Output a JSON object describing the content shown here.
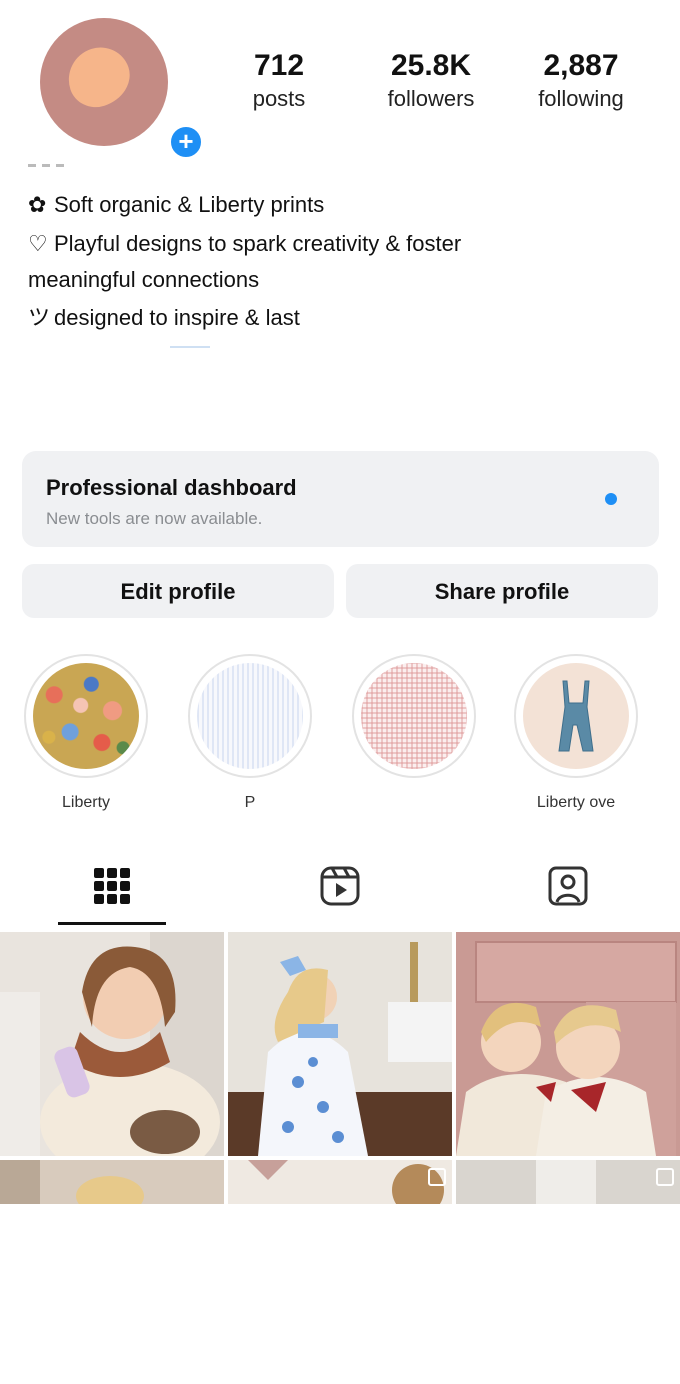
{
  "profile": {
    "stats": [
      {
        "value": "712",
        "label": "posts"
      },
      {
        "value": "25.8K",
        "label": "followers"
      },
      {
        "value": "2,887",
        "label": "following"
      }
    ],
    "add_story_symbol": "+",
    "bio": [
      {
        "icon": "✿",
        "text": "Soft organic & Liberty prints"
      },
      {
        "icon": "♡",
        "text": "Playful designs to spark creativity & foster"
      },
      {
        "icon": "",
        "text": "meaningful connections"
      },
      {
        "icon": "ツ",
        "text": "designed to inspire & last"
      }
    ]
  },
  "dashboard": {
    "title": "Professional dashboard",
    "subtitle": "New tools are now available.",
    "accent": "#1e8ff5"
  },
  "buttons": {
    "edit": "Edit profile",
    "share": "Share profile"
  },
  "highlights": [
    {
      "label": "Liberty",
      "icon": "floral-swatch"
    },
    {
      "label": "P",
      "icon": "stripe-swatch"
    },
    {
      "label": "",
      "icon": "gingham-swatch"
    },
    {
      "label": "Liberty ove",
      "icon": "overalls-swatch"
    }
  ],
  "tabs": [
    {
      "name": "grid",
      "icon": "grid-icon",
      "active": true
    },
    {
      "name": "reels",
      "icon": "reels-icon",
      "active": false
    },
    {
      "name": "tagged",
      "icon": "tagged-icon",
      "active": false
    }
  ],
  "posts": [
    {
      "subject": "toddler in cream cardigan with floral scarf"
    },
    {
      "subject": "toddler with blue bow in butterfly dress"
    },
    {
      "subject": "two toddlers with bows in pink room"
    },
    {
      "subject": "child with bow"
    },
    {
      "subject": "interior"
    },
    {
      "subject": "interior"
    }
  ],
  "colors": {
    "accent_blue": "#1e8ff5",
    "button_bg": "#f0f1f3",
    "avatar_bg": "#c48b84"
  }
}
